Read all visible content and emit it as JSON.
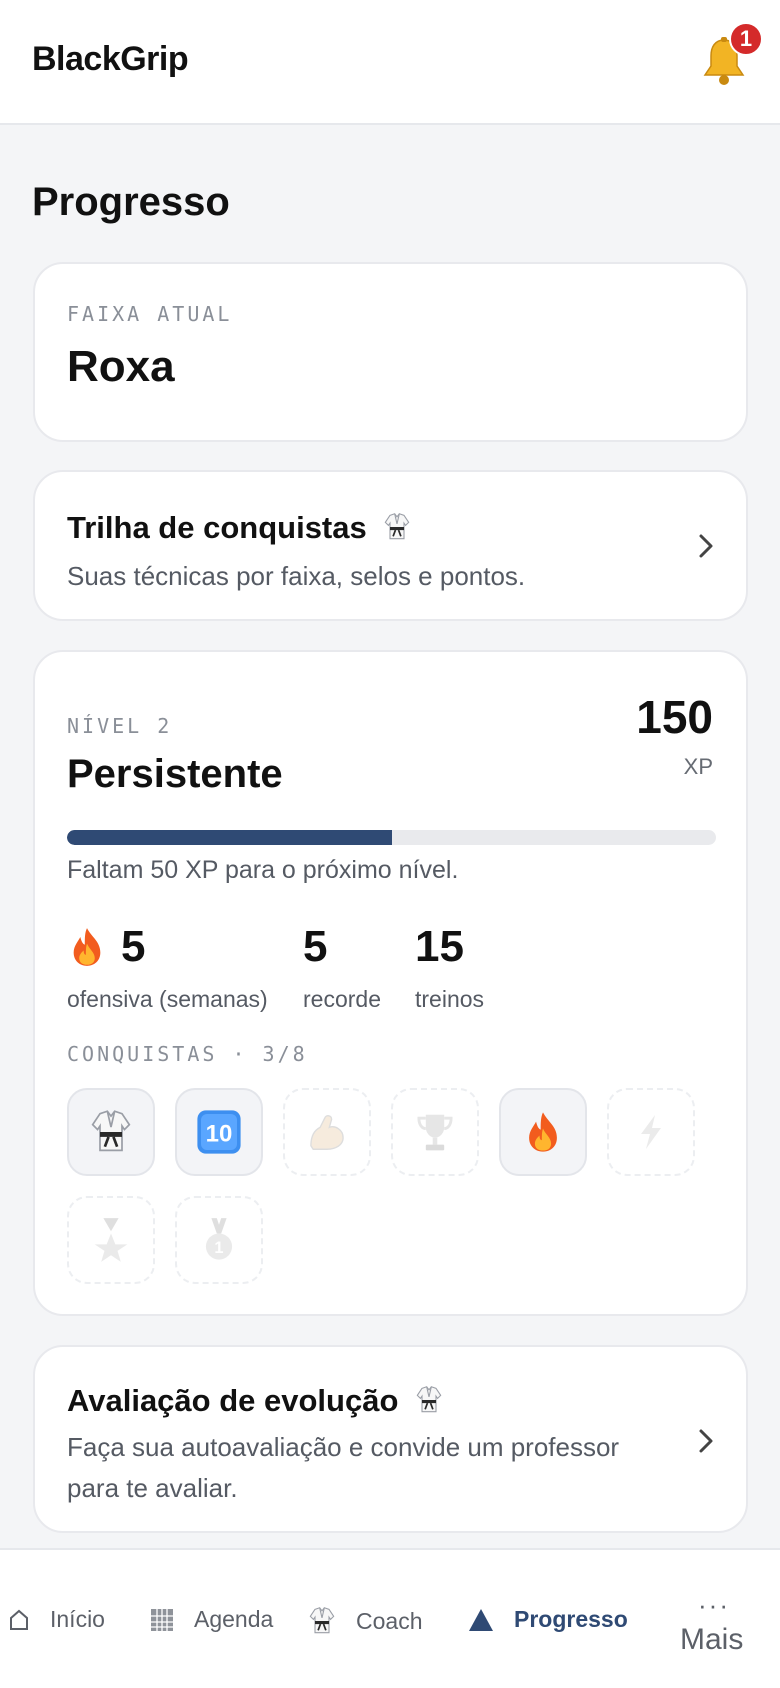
{
  "header": {
    "brand": "BlackGrip",
    "notification_count": "1"
  },
  "page": {
    "title": "Progresso"
  },
  "belt": {
    "label": "FAIXA ATUAL",
    "value": "Roxa"
  },
  "trail": {
    "title": "Trilha de conquistas",
    "subtitle": "Suas técnicas por faixa, selos e pontos."
  },
  "level": {
    "label": "NÍVEL 2",
    "name": "Persistente",
    "xp": "150",
    "xp_unit": "XP",
    "progress_fraction": 0.5,
    "progress_note": "Faltam 50 XP para o próximo nível.",
    "stats": [
      {
        "value": "5",
        "label": "ofensiva (semanas)",
        "icon": "flame-icon"
      },
      {
        "value": "5",
        "label": "recorde"
      },
      {
        "value": "15",
        "label": "treinos"
      }
    ],
    "achievements_label": "CONQUISTAS · 3/8",
    "achievements": [
      {
        "icon": "gi-icon",
        "unlocked": true
      },
      {
        "icon": "keycap-ten-icon",
        "unlocked": true
      },
      {
        "icon": "flexed-biceps-icon",
        "unlocked": false
      },
      {
        "icon": "trophy-icon",
        "unlocked": false
      },
      {
        "icon": "flame-icon",
        "unlocked": true
      },
      {
        "icon": "lightning-icon",
        "unlocked": false
      },
      {
        "icon": "star-medal-icon",
        "unlocked": false
      },
      {
        "icon": "first-medal-icon",
        "unlocked": false
      }
    ]
  },
  "evaluation": {
    "title": "Avaliação de evolução",
    "subtitle": "Faça sua autoavaliação e convide um professor para te avaliar."
  },
  "nav": {
    "items": [
      {
        "label": "Início",
        "icon": "home-icon"
      },
      {
        "label": "Agenda",
        "icon": "calendar-grid-icon"
      },
      {
        "label": "Coach",
        "icon": "gi-icon"
      },
      {
        "label": "Progresso",
        "icon": "triangle-icon",
        "active": true
      }
    ],
    "more_label": "Mais"
  },
  "colors": {
    "accent": "#2f4a74",
    "badge_red": "#d42a2a",
    "background": "#f4f5f7"
  }
}
